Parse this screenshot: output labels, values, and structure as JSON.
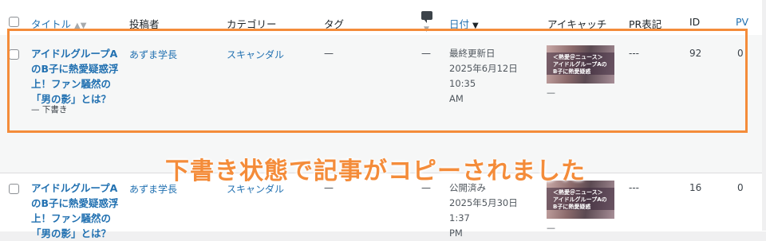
{
  "header": {
    "title": "タイトル",
    "author": "投稿者",
    "category": "カテゴリー",
    "tags": "タグ",
    "date": "日付",
    "eyecatch": "アイキャッチ",
    "pr": "PR表記",
    "id": "ID",
    "pv": "PV",
    "sort_neutral": "▲▼",
    "sort_desc": "▼"
  },
  "rows": [
    {
      "title_lines": [
        "アイドルグループA",
        "のB子に熱愛疑惑浮",
        "上！ファン騒然の",
        "「男の影」とは？"
      ],
      "status": "— 下書き",
      "author": "あずま学長",
      "category": "スキャンダル",
      "tags": "—",
      "comments": "—",
      "date_status": "最終更新日",
      "date_line1": "2025年6月12日 10:35",
      "date_line2": "AM",
      "thumb_line1": "＜熱愛＠ニュース＞",
      "thumb_line2": "アイドルグループAの",
      "thumb_line3": "B子に熱愛疑惑",
      "thumb_dash": "—",
      "pr": "---",
      "id": "92",
      "pv": "0"
    },
    {
      "title_lines": [
        "アイドルグループA",
        "のB子に熱愛疑惑浮",
        "上！ファン騒然の",
        "「男の影」とは？"
      ],
      "author": "あずま学長",
      "category": "スキャンダル",
      "tags": "—",
      "comments": "—",
      "date_status": "公開済み",
      "date_line1": "2025年5月30日 1:37",
      "date_line2": "PM",
      "thumb_line1": "＜熱愛＠ニュース＞",
      "thumb_line2": "アイドルグループAの",
      "thumb_line3": "B子に熱愛疑惑",
      "thumb_dash": "—",
      "pr": "---",
      "id": "16",
      "pv": "0"
    }
  ],
  "annotation": {
    "banner": "下書き状態で記事がコピーされました",
    "color": "#f48c3a"
  }
}
